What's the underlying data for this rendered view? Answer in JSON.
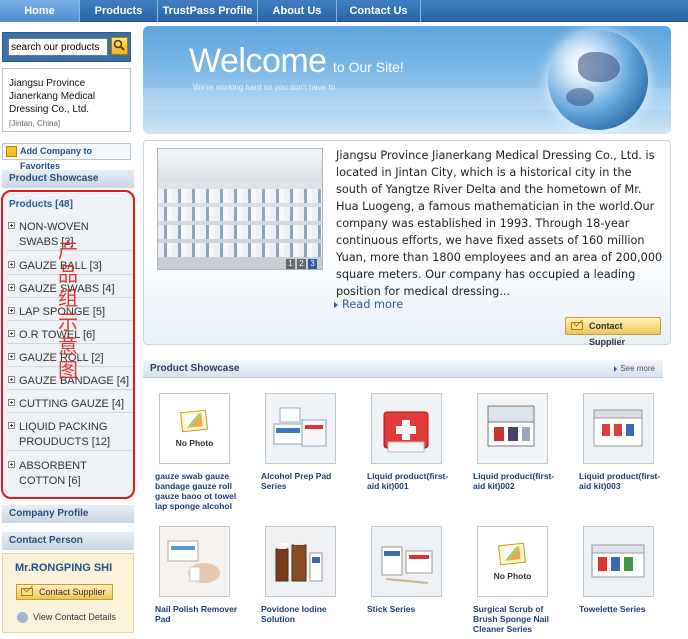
{
  "nav": {
    "tabs": [
      {
        "label": "Home",
        "active": true
      },
      {
        "label": "Products",
        "active": false
      },
      {
        "label": "TrustPass Profile",
        "active": false
      },
      {
        "label": "About Us",
        "active": false
      },
      {
        "label": "Contact Us",
        "active": false
      }
    ]
  },
  "sidebar": {
    "search_placeholder": "search our products",
    "company_name_line1": "Jiangsu Province",
    "company_name_line2": "Jianerkang Medical",
    "company_name_line3": "Dressing Co., Ltd.",
    "company_location": "[Jintan, China]",
    "add_favorites": "Add Company to Favorites",
    "product_showcase_head": "Product Showcase",
    "products_title": "Products [48]",
    "categories": [
      {
        "line1": "NON-WOVEN",
        "line2": "SWABS [2]"
      },
      {
        "line1": "GAUZE BALL [3]",
        "line2": ""
      },
      {
        "line1": "GAUZE SWABS [4]",
        "line2": ""
      },
      {
        "line1": "LAP SPONGE [5]",
        "line2": ""
      },
      {
        "line1": "O.R TOWEL [6]",
        "line2": ""
      },
      {
        "line1": "GAUZE ROLL [2]",
        "line2": ""
      },
      {
        "line1": "GAUZE BANDAGE [4]",
        "line2": ""
      },
      {
        "line1": "CUTTING GAUZE [4]",
        "line2": ""
      },
      {
        "line1": "LIQUID PACKING",
        "line2": "PROUDUCTS [12]"
      },
      {
        "line1": "ABSORBENT",
        "line2": "COTTON [6]"
      }
    ],
    "overlay_chars": [
      "产",
      "品",
      "组",
      "示",
      "意",
      "图"
    ],
    "company_profile_head": "Company Profile",
    "contact_person_head": "Contact Person",
    "contact_name": "Mr.RONGPING SHI",
    "contact_supplier": "Contact Supplier",
    "view_contact": "View Contact Details"
  },
  "banner": {
    "welcome": "Welcome",
    "sub": "to Our Site!",
    "tagline": "We're working hard so you don't have to"
  },
  "about": {
    "text": "Jiangsu Province Jianerkang Medical Dressing Co., Ltd. is located in Jintan City, which is a historical city in the south of Yangtze River Delta and the hometown of Mr. Hua Luogeng, a famous mathematician in the world.Our company was established in 1993. Through 18-year continuous efforts, we have fixed assets of 160 million Yuan, more than 1800 employees and an area of 200,000 square meters. Our company has occupied a leading position for medical dressing...",
    "read_more": "Read more",
    "contact_supplier": "Contact Supplier",
    "pager": [
      "1",
      "2",
      "3"
    ]
  },
  "showcase": {
    "title": "Product Showcase",
    "see_more": "See more",
    "no_photo": "No Photo",
    "products": [
      {
        "name": "gauze swab gauze bandage gauze roll gauze baoo ot towel lap sponge alcohol",
        "photo": false
      },
      {
        "name": "Alcohol Prep Pad Series",
        "photo": true
      },
      {
        "name": "Liquid product(first-aid kit)001",
        "photo": true
      },
      {
        "name": "Liquid product(first-aid kit)002",
        "photo": true
      },
      {
        "name": "Liquid product(first-aid kit)003",
        "photo": true
      },
      {
        "name": "Nail Polish Remover Pad",
        "photo": true
      },
      {
        "name": "Povidone Iodine Solution",
        "photo": true
      },
      {
        "name": "Stick Series",
        "photo": true
      },
      {
        "name": "Surgical Scrub of Brush Sponge Nail Cleaner Series",
        "photo": false
      },
      {
        "name": "Towelette Series",
        "photo": true
      }
    ]
  }
}
